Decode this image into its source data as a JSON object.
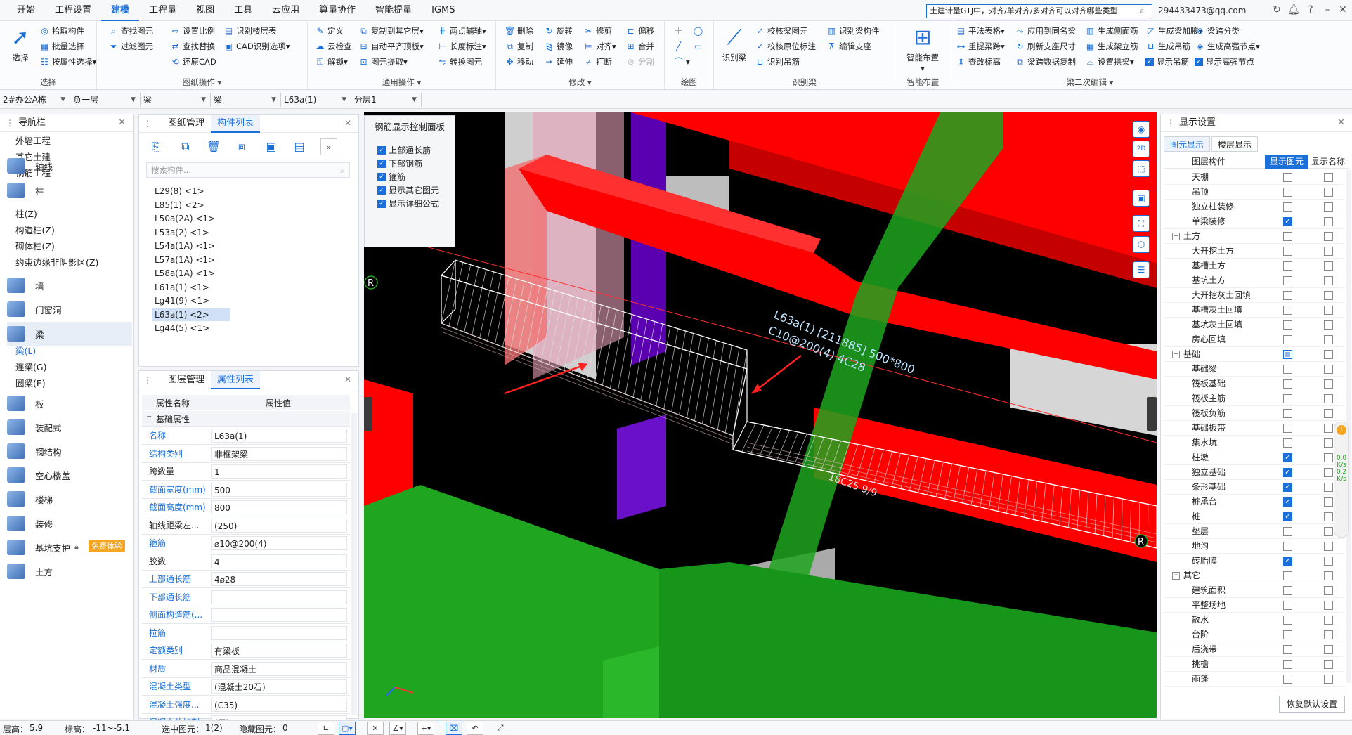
{
  "menu": [
    "开始",
    "工程设置",
    "建模",
    "工程量",
    "视图",
    "工具",
    "云应用",
    "算量协作",
    "智能提量",
    "IGMS"
  ],
  "menu_active": "建模",
  "search": {
    "text": "土建计量GTJ中，对齐/单对齐/多对齐可以对齐哪些类型"
  },
  "account": "294433473@qq.com",
  "ribbon": {
    "select": {
      "title": "选择",
      "big": "选择",
      "items": [
        "拾取构件",
        "批量选择",
        "按属性选择"
      ]
    },
    "drawing_ops": {
      "title": "图纸操作",
      "items": [
        "查找图元",
        "过滤图元",
        "设置比例",
        "查找替换",
        "还原CAD",
        "识别楼层表",
        "CAD识别选项"
      ]
    },
    "general_ops": {
      "title": "通用操作",
      "items": [
        "定义",
        "云检查",
        "解锁",
        "复制到其它层",
        "自动平齐顶板",
        "图元提取",
        "两点辅轴",
        "长度标注",
        "转换图元"
      ]
    },
    "modify": {
      "title": "修改",
      "items": [
        "删除",
        "复制",
        "移动",
        "旋转",
        "镜像",
        "延伸",
        "修剪",
        "对齐",
        "打断",
        "偏移",
        "合并",
        "分割"
      ]
    },
    "draw": {
      "title": "绘图"
    },
    "identify": {
      "title": "识别梁",
      "big": "识别梁",
      "items": [
        "校核梁图元",
        "校核原位标注",
        "识别吊筋",
        "识别梁构件",
        "编辑支座"
      ]
    },
    "smart": {
      "title": "智能布置",
      "big": "智能布置"
    },
    "beam2": {
      "title": "梁二次编辑",
      "items": [
        "平法表格",
        "重提梁跨",
        "查改标高",
        "应用到同名梁",
        "刷新支座尺寸",
        "梁跨数据复制",
        "生成侧面筋",
        "生成架立筋",
        "设置拱梁",
        "生成梁加腋",
        "生成吊筋",
        "显示吊筋",
        "梁跨分类",
        "生成高强节点",
        "显示高强节点"
      ]
    }
  },
  "selectors": [
    "2#办公A栋",
    "负一层",
    "梁",
    "梁",
    "L63a(1)",
    "分层1"
  ],
  "nav": {
    "title": "导航栏",
    "top": [
      "外墙工程",
      "其它土建",
      "钢筋工程"
    ],
    "cats": [
      "轴线",
      "柱",
      "墙",
      "门窗洞",
      "梁",
      "板",
      "装配式",
      "钢结构",
      "空心楼盖",
      "楼梯",
      "装修",
      "基坑支护",
      "土方"
    ],
    "col_subs": [
      "柱(Z)",
      "构造柱(Z)",
      "砌体柱(Z)",
      "约束边缘非阴影区(Z)"
    ],
    "beam_subs": [
      "梁(L)",
      "连梁(G)",
      "圈梁(E)"
    ],
    "badge": "免费体验"
  },
  "complist": {
    "tabs": [
      "图纸管理",
      "构件列表"
    ],
    "search_placeholder": "搜索构件...",
    "items": [
      "L29(8) <1>",
      "L85(1) <2>",
      "L50a(2A) <1>",
      "L53a(2) <1>",
      "L54a(1A) <1>",
      "L57a(1A) <1>",
      "L58a(1A) <1>",
      "L61a(1) <1>",
      "Lg41(9) <1>",
      "L63a(1) <2>",
      "Lg44(5) <1>"
    ],
    "active_index": 9
  },
  "props": {
    "tabs": [
      "图层管理",
      "属性列表"
    ],
    "col_name": "属性名称",
    "col_value": "属性值",
    "group": "基础属性",
    "rows": [
      {
        "n": "名称",
        "v": "L63a(1)"
      },
      {
        "n": "结构类别",
        "v": "非框架梁"
      },
      {
        "n": "跨数量",
        "v": "1"
      },
      {
        "n": "截面宽度(mm)",
        "v": "500"
      },
      {
        "n": "截面高度(mm)",
        "v": "800"
      },
      {
        "n": "轴线距梁左...",
        "v": "(250)"
      },
      {
        "n": "箍筋",
        "v": "⌀10@200(4)"
      },
      {
        "n": "胶数",
        "v": "4"
      },
      {
        "n": "上部通长筋",
        "v": "4⌀28"
      },
      {
        "n": "下部通长筋",
        "v": ""
      },
      {
        "n": "侧面构造筋(...",
        "v": ""
      },
      {
        "n": "拉筋",
        "v": ""
      },
      {
        "n": "定额类别",
        "v": "有梁板"
      },
      {
        "n": "材质",
        "v": "商品混凝土"
      },
      {
        "n": "混凝土类型",
        "v": "(混凝土20石)"
      },
      {
        "n": "混凝土强度...",
        "v": "(C35)"
      },
      {
        "n": "混凝土外加剂",
        "v": "(无)"
      }
    ]
  },
  "rebar_panel": {
    "title": "钢筋显示控制面板",
    "items": [
      "上部通长筋",
      "下部钢筋",
      "箍筋",
      "显示其它图元",
      "显示详细公式"
    ]
  },
  "viewport": {
    "label1": "L63a(1) [211885] 500*800",
    "label2": "C10@200(4) 4C28",
    "label3": "18C25 9/9",
    "axis": "R",
    "colors": {
      "red": "#ff0000",
      "green": "#1fa51f",
      "purple": "#5a00b0",
      "grey": "#c8c8c8"
    }
  },
  "display": {
    "title": "显示设置",
    "tabs": [
      "图元显示",
      "楼层显示"
    ],
    "col1": "图层构件",
    "col2": "显示图元",
    "col3": "显示名称",
    "rows": [
      {
        "name": "天棚",
        "cat": false,
        "a": "off"
      },
      {
        "name": "吊顶",
        "cat": false,
        "a": "off"
      },
      {
        "name": "独立柱装修",
        "cat": false,
        "a": "off"
      },
      {
        "name": "单梁装修",
        "cat": false,
        "a": "on"
      },
      {
        "name": "土方",
        "cat": true,
        "a": "off"
      },
      {
        "name": "大开挖土方",
        "cat": false,
        "a": "off"
      },
      {
        "name": "基槽土方",
        "cat": false,
        "a": "off"
      },
      {
        "name": "基坑土方",
        "cat": false,
        "a": "off"
      },
      {
        "name": "大开挖灰土回填",
        "cat": false,
        "a": "off"
      },
      {
        "name": "基槽灰土回填",
        "cat": false,
        "a": "off"
      },
      {
        "name": "基坑灰土回填",
        "cat": false,
        "a": "off"
      },
      {
        "name": "房心回填",
        "cat": false,
        "a": "off"
      },
      {
        "name": "基础",
        "cat": true,
        "a": "part"
      },
      {
        "name": "基础梁",
        "cat": false,
        "a": "off"
      },
      {
        "name": "筏板基础",
        "cat": false,
        "a": "off"
      },
      {
        "name": "筏板主筋",
        "cat": false,
        "a": "off"
      },
      {
        "name": "筏板负筋",
        "cat": false,
        "a": "off"
      },
      {
        "name": "基础板带",
        "cat": false,
        "a": "off"
      },
      {
        "name": "集水坑",
        "cat": false,
        "a": "off"
      },
      {
        "name": "柱墩",
        "cat": false,
        "a": "on"
      },
      {
        "name": "独立基础",
        "cat": false,
        "a": "on"
      },
      {
        "name": "条形基础",
        "cat": false,
        "a": "on"
      },
      {
        "name": "桩承台",
        "cat": false,
        "a": "on"
      },
      {
        "name": "桩",
        "cat": false,
        "a": "on"
      },
      {
        "name": "垫层",
        "cat": false,
        "a": "off"
      },
      {
        "name": "地沟",
        "cat": false,
        "a": "off"
      },
      {
        "name": "砖胎膜",
        "cat": false,
        "a": "on"
      },
      {
        "name": "其它",
        "cat": true,
        "a": "off"
      },
      {
        "name": "建筑面积",
        "cat": false,
        "a": "off"
      },
      {
        "name": "平整场地",
        "cat": false,
        "a": "off"
      },
      {
        "name": "散水",
        "cat": false,
        "a": "off"
      },
      {
        "name": "台阶",
        "cat": false,
        "a": "off"
      },
      {
        "name": "后浇带",
        "cat": false,
        "a": "off"
      },
      {
        "name": "挑檐",
        "cat": false,
        "a": "off"
      },
      {
        "name": "雨蓬",
        "cat": false,
        "a": "off"
      }
    ],
    "restore": "恢复默认设置"
  },
  "status": {
    "floor_h": "层高：",
    "floor_h_v": "5.9",
    "elev": "标高：",
    "elev_v": "-11~-5.1",
    "sel": "选中图元：",
    "sel_v": "1(2)",
    "hidden": "隐藏图元：",
    "hidden_v": "0"
  },
  "sidegauge": {
    "a": "0.0",
    "b": "0.2",
    "unit": "K/s"
  }
}
